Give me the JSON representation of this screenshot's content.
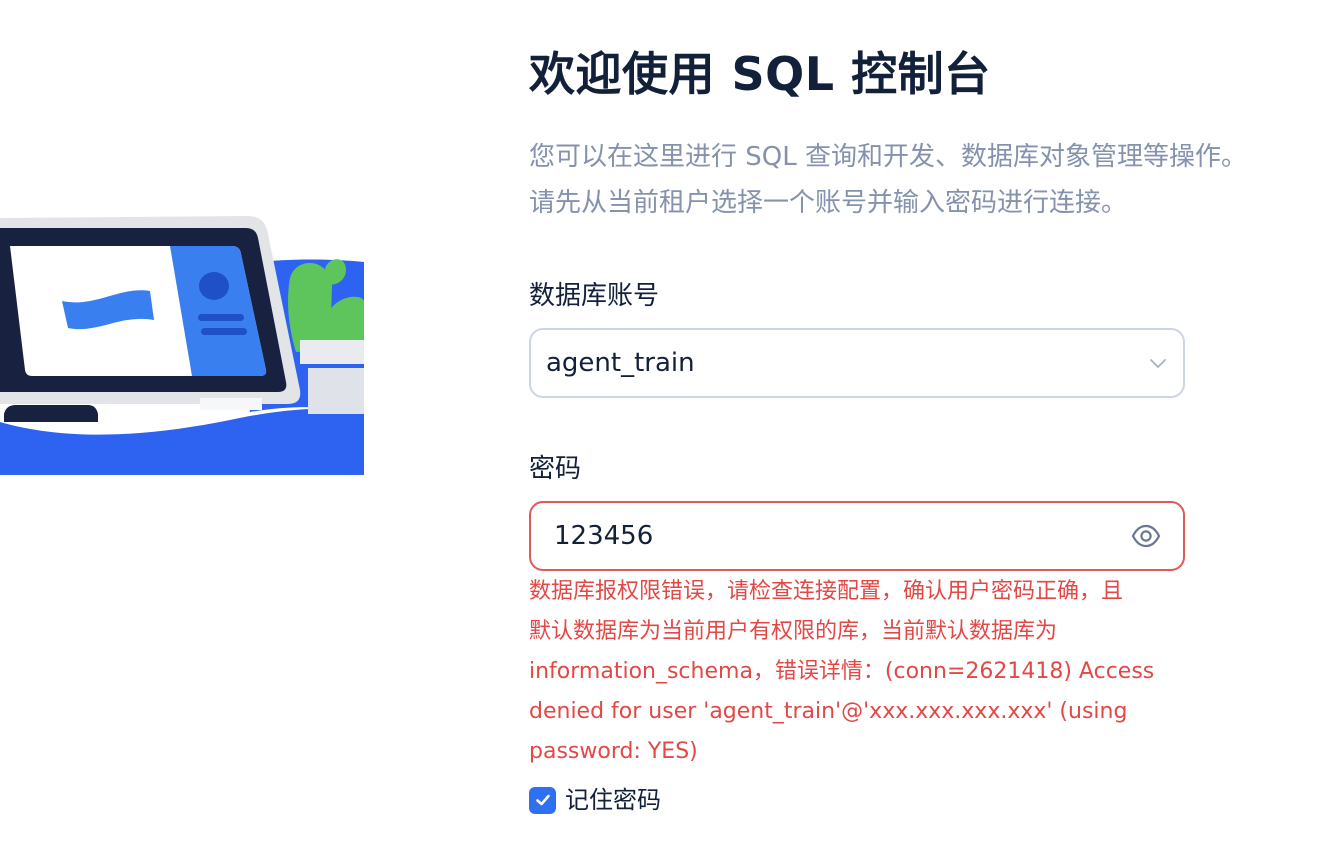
{
  "header": {
    "title": "欢迎使用 SQL 控制台",
    "description_lines": [
      "您可以在这里进行 SQL 查询和开发、数据库对象管理等操作。",
      "请先从当前租户选择一个账号并输入密码进行连接。"
    ]
  },
  "form": {
    "account": {
      "label": "数据库账号",
      "value": "agent_train",
      "icon": "chevron-down-icon"
    },
    "password": {
      "label": "密码",
      "value": "123456",
      "icon": "eye-icon"
    },
    "error_lines": [
      "数据库报权限错误，请检查连接配置，确认用户密码正确，且",
      "默认数据库为当前用户有权限的库，当前默认数据库为",
      "information_schema，错误详情：(conn=2621418) Access",
      "denied for user 'agent_train'@'xxx.xxx.xxx.xxx' (using",
      "password: YES)"
    ],
    "remember": {
      "label": "记住密码",
      "checked": true
    }
  },
  "colors": {
    "accent": "#2f6ff1",
    "error": "#e24846",
    "muted_text": "#8592ad",
    "text": "#132039"
  }
}
